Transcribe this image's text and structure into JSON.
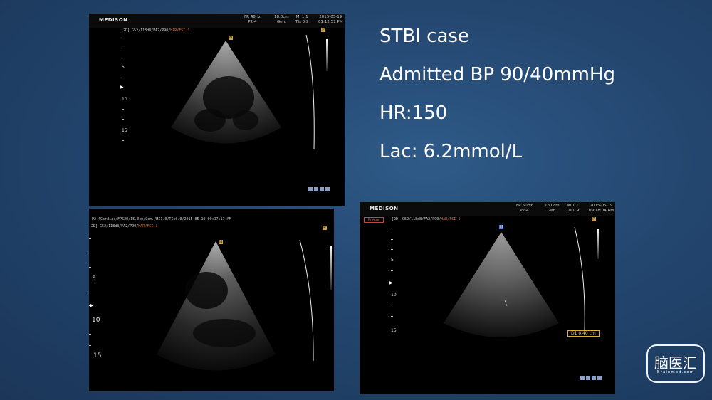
{
  "slide": {
    "lines": [
      "STBI case",
      "Admitted BP 90/40mmHg",
      "HR:150",
      "Lac:  6.2mmol/L"
    ]
  },
  "us1": {
    "brand": "MEDISON",
    "params": [
      {
        "l1": "FR 46Hz",
        "l2": "P2-4"
      },
      {
        "l1": "18.0cm",
        "l2": "Gen."
      },
      {
        "l1": "MI 1.1",
        "l2": "TIs 0.9"
      },
      {
        "l1": "2015-05-19",
        "l2": "01:12:51 PM"
      }
    ],
    "preset_main": "[2D] G52/118dB/FA2/P90/",
    "preset_hl": "HAR/FSI 1",
    "depth": [
      "5",
      "10",
      "15"
    ]
  },
  "us2": {
    "header": "P2-4Cardiac/FPS20/15.0cm/Gen./MI1.0/TIs0.0/2015-05-19 09:17:17 AM",
    "preset_main": "[2D] G52/118dB/FA2/P90/",
    "preset_hl": "HAR/FSI 1",
    "depth": [
      "5",
      "10",
      "15"
    ]
  },
  "us3": {
    "brand": "MEDISON",
    "params": [
      {
        "l1": "FR 50Hz",
        "l2": "P2-4"
      },
      {
        "l1": "18.0cm",
        "l2": "Gen."
      },
      {
        "l1": "MI 1.1",
        "l2": "TIs 0.9"
      },
      {
        "l1": "2015-05-19",
        "l2": "09:18:04 AM"
      }
    ],
    "freeze": "Freeze",
    "preset_main": "[2D] G52/118dB/FA2/P90/",
    "preset_hl": "HAR/FSI 1",
    "depth": [
      "5",
      "10",
      "15"
    ],
    "measurement": "D1  0.40 cm"
  },
  "logo": {
    "main": "脑医汇",
    "sub": "Brainmed.com"
  }
}
